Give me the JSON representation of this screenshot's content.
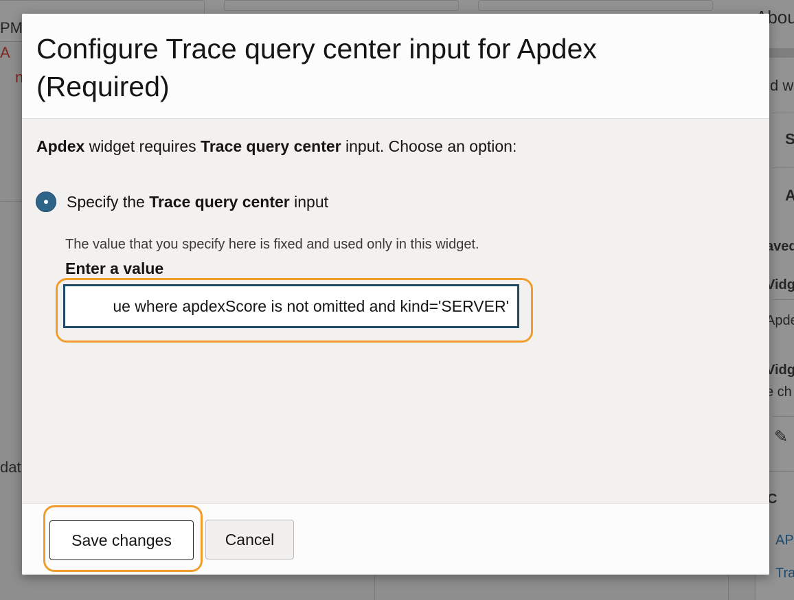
{
  "background": {
    "top_left_text": "PM",
    "top_right_text": "Abou",
    "red_text_1": "A",
    "red_text_2": "n",
    "left_text": "dat",
    "right_fragments": [
      "d w",
      "S",
      "A",
      "aved",
      "Vidg",
      "Apde",
      "Vidg",
      "e ch",
      "C",
      "AP",
      "Tra"
    ]
  },
  "dialog": {
    "title": "Configure Trace query center input for Apdex (Required)",
    "intro": {
      "widget_name": "Apdex",
      "middle_text": " widget requires ",
      "input_name": "Trace query center",
      "end_text": " input. Choose an option:"
    },
    "option": {
      "prefix": "Specify the ",
      "input_name": "Trace query center",
      "suffix": " input",
      "selected": true
    },
    "help_text": "The value that you specify here is fixed and used only in this widget.",
    "field_label": "Enter a value",
    "field_value": "ue where apdexScore is not omitted and kind='SERVER'",
    "buttons": {
      "save": "Save changes",
      "cancel": "Cancel"
    }
  },
  "colors": {
    "highlight": "#f09d2d",
    "radio_selected": "#2f6489",
    "input_border": "#1f4a66"
  }
}
